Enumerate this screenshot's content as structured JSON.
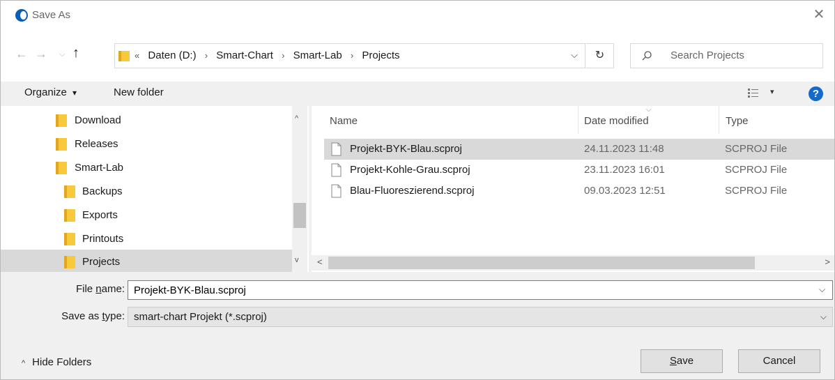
{
  "window": {
    "title": "Save As",
    "close_glyph": "✕"
  },
  "nav": {
    "back_glyph": "←",
    "forward_glyph": "→",
    "recent_glyph": "⌵",
    "up_glyph": "↑",
    "address": {
      "overflow_glyph": "«",
      "crumbs": [
        "Daten (D:)",
        "Smart-Chart",
        "Smart-Lab",
        "Projects"
      ],
      "dropdown_glyph": "⌵"
    },
    "refresh_glyph": "↻",
    "search": {
      "placeholder": "Search Projects"
    }
  },
  "toolbar": {
    "organize_label": "Organize",
    "organize_caret": "▾",
    "new_folder_label": "New folder",
    "views_caret": "▾",
    "help_glyph": "?"
  },
  "tree": {
    "items": [
      {
        "label": "Download",
        "indent": 1
      },
      {
        "label": "Releases",
        "indent": 1
      },
      {
        "label": "Smart-Lab",
        "indent": 1
      },
      {
        "label": "Backups",
        "indent": 2
      },
      {
        "label": "Exports",
        "indent": 2
      },
      {
        "label": "Printouts",
        "indent": 2
      },
      {
        "label": "Projects",
        "indent": 2,
        "selected": true
      }
    ],
    "scroll_up": "^",
    "scroll_down": "v"
  },
  "filelist": {
    "columns": {
      "name": "Name",
      "date": "Date modified",
      "type": "Type"
    },
    "sort_glyph": "⌵",
    "files": [
      {
        "name": "Projekt-BYK-Blau.scproj",
        "date": "24.11.2023 11:48",
        "type": "SCPROJ File",
        "selected": true
      },
      {
        "name": "Projekt-Kohle-Grau.scproj",
        "date": "23.11.2023 16:01",
        "type": "SCPROJ File"
      },
      {
        "name": "Blau-Fluoreszierend.scproj",
        "date": "09.03.2023 12:51",
        "type": "SCPROJ File"
      }
    ],
    "scroll_left": "<",
    "scroll_right": ">"
  },
  "form": {
    "file_name_label_pre": "File ",
    "file_name_label_u": "n",
    "file_name_label_post": "ame:",
    "file_name_value": "Projekt-BYK-Blau.scproj",
    "save_type_label_pre": "Save as ",
    "save_type_label_u": "t",
    "save_type_label_post": "ype:",
    "save_type_value": "smart-chart Projekt (*.scproj)",
    "dropdown_glyph": "⌵"
  },
  "footer": {
    "hide_folders_glyph": "^",
    "hide_folders_label": "Hide Folders",
    "save_u": "S",
    "save_rest": "ave",
    "cancel_label": "Cancel"
  },
  "colors": {
    "folder": "#f8c93a",
    "accent": "#1569c7",
    "selection": "#d9d9d9"
  }
}
